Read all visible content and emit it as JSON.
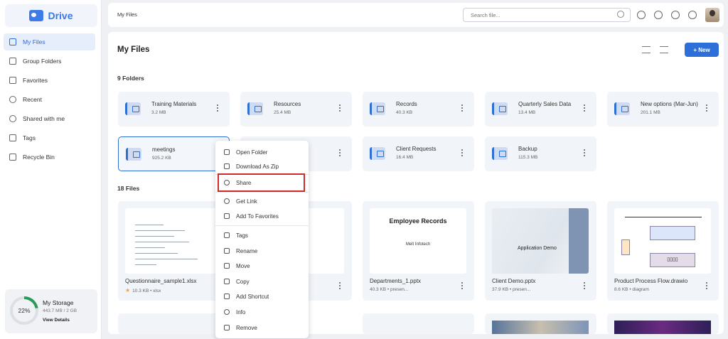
{
  "sidebar": {
    "brand": "Drive",
    "items": [
      {
        "label": "My Files",
        "icon": "file-icon",
        "active": true
      },
      {
        "label": "Group Folders",
        "icon": "group-folder-icon"
      },
      {
        "label": "Favorites",
        "icon": "star-icon"
      },
      {
        "label": "Recent",
        "icon": "clock-icon"
      },
      {
        "label": "Shared with me",
        "icon": "share-icon"
      },
      {
        "label": "Tags",
        "icon": "tag-icon"
      },
      {
        "label": "Recycle Bin",
        "icon": "trash-icon"
      }
    ],
    "storage": {
      "percent": "22%",
      "title": "My Storage",
      "size": "443.7 MB / 2 GB",
      "link": "View Details"
    }
  },
  "topbar": {
    "breadcrumb": "My Files",
    "search_placeholder": "Search file...",
    "icons": [
      "search-icon",
      "moon-icon",
      "globe-icon",
      "settings-icon",
      "info-icon",
      "avatar"
    ]
  },
  "main": {
    "title": "My Files",
    "new_button": "+ New",
    "folders_heading": "9 Folders",
    "files_heading": "18 Files",
    "folders": [
      {
        "name": "Training Materials",
        "size": "3.2 MB"
      },
      {
        "name": "Resources",
        "size": "25.4 MB"
      },
      {
        "name": "Records",
        "size": "40.3 KB"
      },
      {
        "name": "Quarterly Sales Data",
        "size": "13.4 MB"
      },
      {
        "name": "New options (Mar-Jun)",
        "size": "201.1 MB"
      },
      {
        "name": "meetings",
        "size": "925.2 KB"
      },
      {
        "name": "",
        "size": ""
      },
      {
        "name": "Client Requests",
        "size": "16.4 MB"
      },
      {
        "name": "Backup",
        "size": "115.3 MB"
      }
    ],
    "files": [
      {
        "name": "Questionnaire_sample1.xlsx",
        "meta": "10.3 KB • xlsx",
        "starred": true
      },
      {
        "name": "",
        "meta": "",
        "starred": false
      },
      {
        "name": "Departments_1.pptx",
        "meta": "40.3 KB • presen...",
        "thumb_title": "Employee Records",
        "thumb_sub": "Melt Infotech"
      },
      {
        "name": "Client Demo.pptx",
        "meta": "37.9 KB • presen...",
        "thumb_text": "Application Demo"
      },
      {
        "name": "Product Process Flow.drawio",
        "meta": "8.6 KB • diagram",
        "thumb_text": "▯▯▯▯"
      }
    ]
  },
  "context_menu": {
    "items": [
      {
        "label": "Open Folder",
        "icon": "folder-open-icon"
      },
      {
        "label": "Download As Zip",
        "icon": "zip-icon"
      },
      {
        "label": "Share",
        "icon": "share-user-icon",
        "highlighted": true
      },
      {
        "label": "Get Link",
        "icon": "link-icon"
      },
      {
        "label": "Add To Favorites",
        "icon": "star-icon"
      },
      {
        "label": "Tags",
        "icon": "tag-icon"
      },
      {
        "label": "Rename",
        "icon": "pencil-icon"
      },
      {
        "label": "Move",
        "icon": "move-icon"
      },
      {
        "label": "Copy",
        "icon": "copy-icon"
      },
      {
        "label": "Add Shortcut",
        "icon": "shortcut-icon"
      },
      {
        "label": "Info",
        "icon": "info-icon"
      },
      {
        "label": "Remove",
        "icon": "trash-icon"
      }
    ]
  },
  "colors": {
    "accent": "#2d6fd9",
    "highlight": "#d02b2b",
    "storage": "#2a9a5b"
  }
}
